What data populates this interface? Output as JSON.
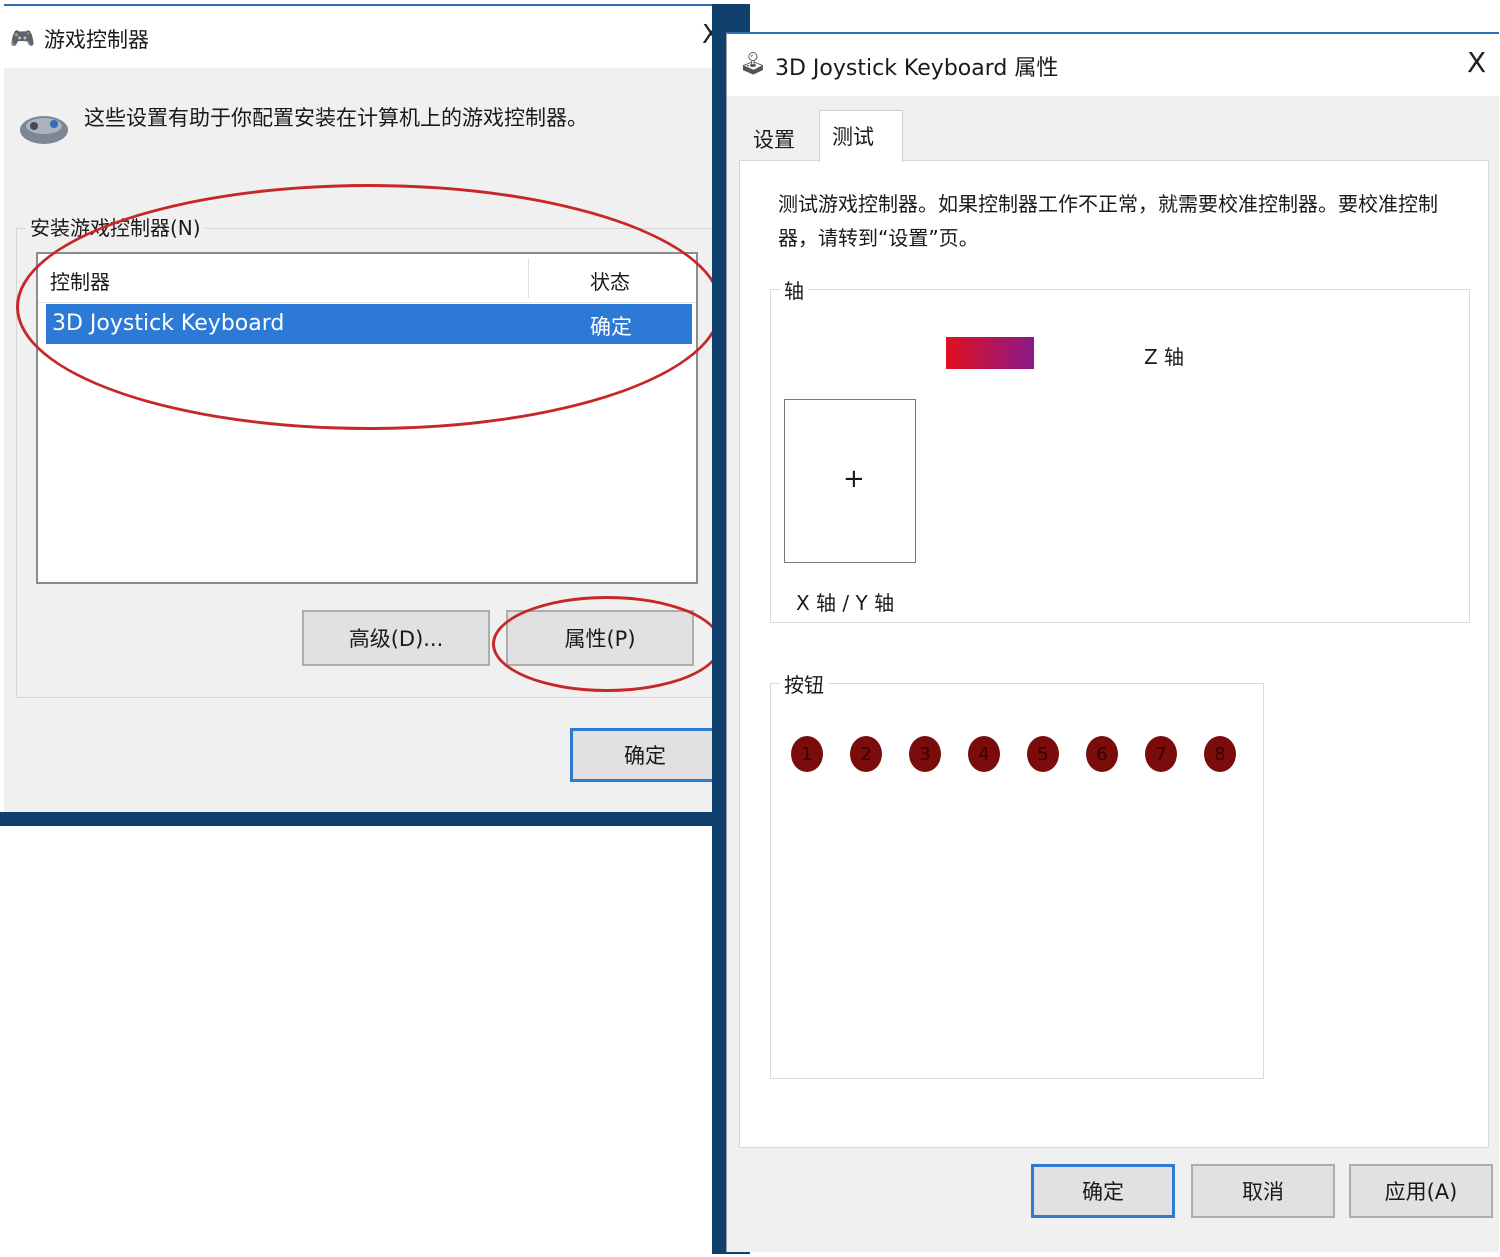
{
  "game_controllers_dialog": {
    "title": "游戏控制器",
    "close_glyph": "X",
    "description": "这些设置有助于你配置安装在计算机上的游戏控制器。",
    "group_label": "安装游戏控制器(N)",
    "columns": {
      "controller": "控制器",
      "status": "状态"
    },
    "rows": [
      {
        "name": "3D Joystick Keyboard",
        "status": "确定"
      }
    ],
    "buttons": {
      "advanced": "高级(D)...",
      "properties": "属性(P)",
      "ok": "确定"
    }
  },
  "properties_dialog": {
    "title": "3D Joystick Keyboard 属性",
    "close_glyph": "X",
    "tabs": [
      {
        "label": "设置",
        "selected": false
      },
      {
        "label": "测试",
        "selected": true
      }
    ],
    "test_description": "测试游戏控制器。如果控制器工作不正常，就需要校准控制器。要校准控制器，请转到“设置”页。",
    "axis_group": {
      "label": "轴",
      "z_axis_label": "Z 轴",
      "xy_axis_label": "X 轴 / Y 轴",
      "crosshair_glyph": "+"
    },
    "buttons_group": {
      "label": "按钮",
      "buttons": [
        "1",
        "2",
        "3",
        "4",
        "5",
        "6",
        "7",
        "8"
      ]
    },
    "footer_buttons": {
      "ok": "确定",
      "cancel": "取消",
      "apply": "应用(A)"
    }
  },
  "colors": {
    "selection": "#2c7ad6",
    "annotation_oval": "#c62828",
    "joystick_button": "#7a0c0c",
    "z_bar_start": "#e01020",
    "z_bar_end": "#8a1a8a"
  },
  "icons": {
    "dialog1_app_icon": "gamepad-icon",
    "dialog1_large_icon": "gamepad-icon",
    "dialog2_app_icon": "joystick-icon"
  }
}
